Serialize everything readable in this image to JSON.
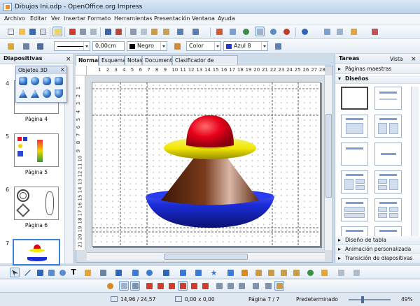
{
  "window": {
    "title": "Dibujos Ini.odp - OpenOffice.org Impress"
  },
  "menu": [
    "Archivo",
    "Editar",
    "Ver",
    "Insertar",
    "Formato",
    "Herramientas",
    "Presentación",
    "Ventana",
    "Ayuda"
  ],
  "line_toolbar": {
    "line_width": "0,00cm",
    "line_color": "Negro",
    "area_style": "Color",
    "area_color": "Azul 8"
  },
  "slides_panel": {
    "title": "Diapositivas",
    "slides": [
      {
        "number": "4",
        "label": "Página 4"
      },
      {
        "number": "5",
        "label": "Página 5"
      },
      {
        "number": "6",
        "label": "Página 6"
      },
      {
        "number": "7",
        "label": ""
      }
    ]
  },
  "floating_toolbar": {
    "title": "Objetos 3D"
  },
  "view_tabs": [
    "Normal",
    "Esquema",
    "Notas",
    "Documento",
    "Clasificador de diapositivas"
  ],
  "active_tab": "Normal",
  "ruler_h": [
    "1",
    "2",
    "3",
    "4",
    "5",
    "6",
    "7",
    "8",
    "9",
    "10",
    "11",
    "12",
    "13",
    "14",
    "15",
    "16",
    "17",
    "18",
    "19",
    "20",
    "21",
    "22",
    "23",
    "24",
    "25",
    "26",
    "27",
    "28"
  ],
  "ruler_v": [
    "1",
    "2",
    "3",
    "4",
    "5",
    "6",
    "7",
    "8",
    "9",
    "10",
    "11",
    "12",
    "13",
    "14",
    "15",
    "16",
    "17",
    "18",
    "19",
    "20",
    "21"
  ],
  "tasks_panel": {
    "title": "Tareas",
    "view_label": "Vista",
    "sections": [
      "Páginas maestras",
      "Diseños"
    ],
    "bottom_sections": [
      "Diseño de tabla",
      "Animación personalizada",
      "Transición de diapositivas"
    ]
  },
  "status": {
    "position": "14,96 / 24,57",
    "size": "0,00 x 0,00",
    "page": "Página 7 / 7",
    "master": "Predeterminado",
    "zoom": "49%"
  },
  "colors": {
    "cone_top": "#e8001a",
    "ring": "#f2e800",
    "cone": "#7a3b1c",
    "base": "#1a2cd8"
  }
}
